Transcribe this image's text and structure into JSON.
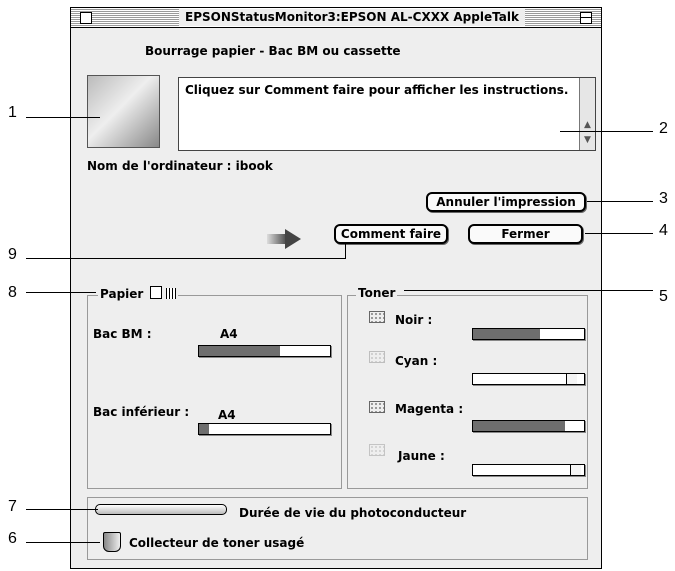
{
  "window": {
    "title": "EPSONStatusMonitor3:EPSON AL-CXXX AppleTalk"
  },
  "status": {
    "heading": "Bourrage papier - Bac BM ou cassette",
    "message": "Cliquez sur Comment faire pour afficher les instructions.",
    "computer_name": "Nom de l'ordinateur : ibook"
  },
  "buttons": {
    "cancel_print": "Annuler l'impression",
    "how_to": "Comment faire",
    "close": "Fermer"
  },
  "paper": {
    "title": "Papier",
    "bac_bm": {
      "label": "Bac BM :",
      "size": "A4",
      "level": 0.62
    },
    "bac_inferieur": {
      "label": "Bac inférieur :",
      "size": "A4",
      "level": 0.08
    }
  },
  "toner": {
    "title": "Toner",
    "items": [
      {
        "label": "Noir :",
        "level": 0.6
      },
      {
        "label": "Cyan :",
        "level": 0.0
      },
      {
        "label": "Magenta :",
        "level": 0.83
      },
      {
        "label": "Jaune :",
        "level": 0.0
      }
    ]
  },
  "consumables": {
    "photoconductor": "Durée de vie du photoconducteur",
    "waste_toner": "Collecteur de toner usagé"
  },
  "callouts": [
    "1",
    "2",
    "3",
    "4",
    "5",
    "6",
    "7",
    "8",
    "9"
  ]
}
